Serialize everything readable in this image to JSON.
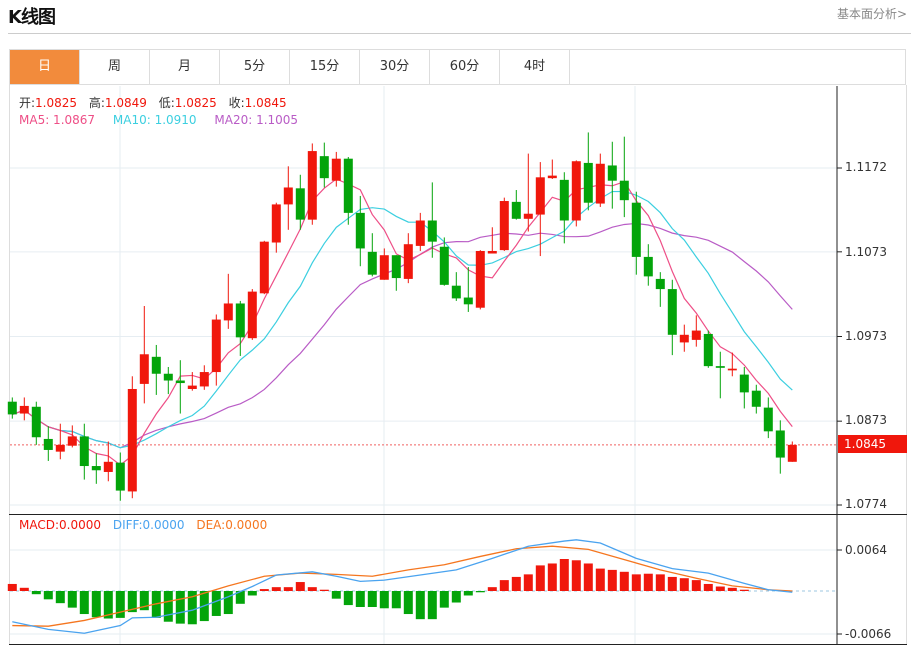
{
  "header": {
    "title": "K线图",
    "more_link": "基本面分析>"
  },
  "tabs": [
    {
      "label": "日",
      "active": true
    },
    {
      "label": "周"
    },
    {
      "label": "月"
    },
    {
      "label": "5分"
    },
    {
      "label": "15分"
    },
    {
      "label": "30分"
    },
    {
      "label": "60分"
    },
    {
      "label": "4时"
    }
  ],
  "ohlc_info": {
    "open_label": "开:",
    "open": "1.0825",
    "high_label": "高:",
    "high": "1.0849",
    "low_label": "低:",
    "low": "1.0825",
    "close_label": "收:",
    "close": "1.0845"
  },
  "ma_info": {
    "ma5": "MA5: 1.0867",
    "ma10": "MA10: 1.0910",
    "ma20": "MA20: 1.1005"
  },
  "macd_info": {
    "macd": "MACD:0.0000",
    "diff": "DIFF:0.0000",
    "dea": "DEA:0.0000"
  },
  "colors": {
    "up": "#f0170c",
    "down": "#03a40a",
    "ma5": "#ee4f87",
    "ma10": "#3ccfe0",
    "ma20": "#b95cc6",
    "diff": "#4aa3ef",
    "dea": "#f5761f",
    "accent": "#f28b3c"
  },
  "chart_data": {
    "type": "candlestick",
    "price_axis": {
      "ticks": [
        "1.1172",
        "1.1073",
        "1.0973",
        "1.0873",
        "1.0774"
      ],
      "range": [
        1.0774,
        1.1172
      ]
    },
    "current_price": "1.0845",
    "candles": [
      [
        1.0896,
        1.0901,
        1.0876,
        1.0881
      ],
      [
        1.0882,
        1.0901,
        1.0874,
        1.0891
      ],
      [
        1.089,
        1.0896,
        1.0845,
        1.0854
      ],
      [
        1.0852,
        1.0867,
        1.0826,
        1.0839
      ],
      [
        1.0837,
        1.087,
        1.0828,
        1.0845
      ],
      [
        1.0844,
        1.0868,
        1.0842,
        1.0855
      ],
      [
        1.0855,
        1.087,
        1.0804,
        1.082
      ],
      [
        1.082,
        1.0835,
        1.0799,
        1.0815
      ],
      [
        1.0813,
        1.0849,
        1.0802,
        1.0825
      ],
      [
        1.0824,
        1.0836,
        1.0779,
        1.0791
      ],
      [
        1.079,
        1.0926,
        1.0782,
        1.0911
      ],
      [
        1.0917,
        1.1009,
        1.0894,
        1.0952
      ],
      [
        1.0949,
        1.0963,
        1.0904,
        1.0929
      ],
      [
        1.0929,
        1.0937,
        1.0905,
        1.0921
      ],
      [
        1.0921,
        1.0945,
        1.0882,
        1.0918
      ],
      [
        1.0911,
        1.0931,
        1.0909,
        1.0915
      ],
      [
        1.0914,
        1.0939,
        1.091,
        1.0931
      ],
      [
        1.0931,
        1.0999,
        1.0915,
        1.0993
      ],
      [
        1.0992,
        1.1047,
        1.0982,
        1.1012
      ],
      [
        1.1012,
        1.1015,
        1.095,
        1.0972
      ],
      [
        1.0971,
        1.1029,
        1.0969,
        1.1026
      ],
      [
        1.1024,
        1.1086,
        1.1023,
        1.1085
      ],
      [
        1.1084,
        1.1131,
        1.1072,
        1.1129
      ],
      [
        1.1129,
        1.1174,
        1.1099,
        1.1149
      ],
      [
        1.1148,
        1.1164,
        1.1099,
        1.1111
      ],
      [
        1.1111,
        1.1201,
        1.1105,
        1.1192
      ],
      [
        1.1186,
        1.1202,
        1.1149,
        1.116
      ],
      [
        1.1157,
        1.1191,
        1.115,
        1.1183
      ],
      [
        1.1183,
        1.1185,
        1.1105,
        1.1119
      ],
      [
        1.1119,
        1.1139,
        1.1056,
        1.1077
      ],
      [
        1.1073,
        1.1095,
        1.1044,
        1.1046
      ],
      [
        1.104,
        1.1077,
        1.104,
        1.1069
      ],
      [
        1.1069,
        1.1069,
        1.1027,
        1.1042
      ],
      [
        1.1041,
        1.1095,
        1.1036,
        1.1082
      ],
      [
        1.108,
        1.1119,
        1.1074,
        1.111
      ],
      [
        1.111,
        1.1155,
        1.1066,
        1.1085
      ],
      [
        1.1079,
        1.109,
        1.1033,
        1.1034
      ],
      [
        1.1033,
        1.1049,
        1.1015,
        1.1018
      ],
      [
        1.1019,
        1.1055,
        1.1002,
        1.1011
      ],
      [
        1.1007,
        1.1075,
        1.1005,
        1.1074
      ],
      [
        1.1071,
        1.1102,
        1.1071,
        1.1074
      ],
      [
        1.1075,
        1.1137,
        1.1074,
        1.1133
      ],
      [
        1.1132,
        1.1146,
        1.1111,
        1.1112
      ],
      [
        1.1112,
        1.1189,
        1.1097,
        1.1118
      ],
      [
        1.1117,
        1.1179,
        1.1068,
        1.1161
      ],
      [
        1.116,
        1.1182,
        1.1159,
        1.1163
      ],
      [
        1.1158,
        1.1167,
        1.1083,
        1.111
      ],
      [
        1.111,
        1.1181,
        1.1103,
        1.118
      ],
      [
        1.1178,
        1.1214,
        1.1122,
        1.1131
      ],
      [
        1.113,
        1.1189,
        1.1126,
        1.1177
      ],
      [
        1.1175,
        1.1203,
        1.1124,
        1.1157
      ],
      [
        1.1157,
        1.1209,
        1.1114,
        1.1134
      ],
      [
        1.1131,
        1.1144,
        1.1046,
        1.1067
      ],
      [
        1.1067,
        1.1082,
        1.1033,
        1.1044
      ],
      [
        1.1041,
        1.1049,
        1.1008,
        1.1029
      ],
      [
        1.1029,
        1.104,
        1.0951,
        1.0975
      ],
      [
        1.0966,
        1.0987,
        1.0955,
        1.0975
      ],
      [
        1.0969,
        1.0998,
        1.0961,
        1.098
      ],
      [
        1.0976,
        1.098,
        1.0936,
        1.0938
      ],
      [
        1.0938,
        1.0955,
        1.09,
        1.0936
      ],
      [
        1.0933,
        1.0954,
        1.0926,
        1.0935
      ],
      [
        1.0928,
        1.0937,
        1.0888,
        1.0907
      ],
      [
        1.0909,
        1.0916,
        1.0882,
        1.089
      ],
      [
        1.0889,
        1.0901,
        1.0853,
        1.0861
      ],
      [
        1.0862,
        1.0874,
        1.0811,
        1.083
      ],
      [
        1.0825,
        1.0849,
        1.0825,
        1.0845
      ]
    ],
    "macd": {
      "axis_ticks": [
        "0.0064",
        "-0.0066"
      ],
      "histogram": [
        0.0011,
        0.0005,
        -0.0005,
        -0.0013,
        -0.0019,
        -0.0026,
        -0.0036,
        -0.0041,
        -0.0043,
        -0.0042,
        -0.0033,
        -0.003,
        -0.0042,
        -0.0048,
        -0.0051,
        -0.0052,
        -0.0047,
        -0.0039,
        -0.0036,
        -0.002,
        -0.0007,
        0.0003,
        0.0006,
        0.0006,
        0.0014,
        0.0006,
        0.0002,
        -0.0012,
        -0.0022,
        -0.0025,
        -0.0025,
        -0.0027,
        -0.0027,
        -0.0036,
        -0.0044,
        -0.0044,
        -0.0026,
        -0.0018,
        -0.0007,
        -0.0002,
        0.0006,
        0.0017,
        0.0022,
        0.0026,
        0.004,
        0.0043,
        0.005,
        0.0048,
        0.0043,
        0.0035,
        0.0033,
        0.003,
        0.0026,
        0.0027,
        0.0026,
        0.0022,
        0.002,
        0.0017,
        0.0011,
        0.0007,
        0.0005,
        0.0002,
        0,
        0,
        0,
        0
      ],
      "diff": [
        [
          0,
          -0.0048
        ],
        [
          3,
          -0.006
        ],
        [
          6,
          -0.0066
        ],
        [
          9,
          -0.0054
        ],
        [
          10,
          -0.0042
        ],
        [
          12,
          -0.0041
        ],
        [
          15,
          -0.003
        ],
        [
          18,
          -0.0009
        ],
        [
          20,
          0.0007
        ],
        [
          22,
          0.0025
        ],
        [
          25,
          0.003
        ],
        [
          27,
          0.0023
        ],
        [
          29,
          0.0015
        ],
        [
          31,
          0.0017
        ],
        [
          34,
          0.0025
        ],
        [
          37,
          0.0033
        ],
        [
          40,
          0.0051
        ],
        [
          43,
          0.007
        ],
        [
          46,
          0.0078
        ],
        [
          47,
          0.008
        ],
        [
          49,
          0.0075
        ],
        [
          52,
          0.0051
        ],
        [
          55,
          0.0035
        ],
        [
          58,
          0.0028
        ],
        [
          61,
          0.0012
        ],
        [
          63,
          0.0002
        ],
        [
          65,
          -0.0002
        ]
      ],
      "dea": [
        [
          0,
          -0.0054
        ],
        [
          3,
          -0.0055
        ],
        [
          6,
          -0.0046
        ],
        [
          9,
          -0.0033
        ],
        [
          12,
          -0.002
        ],
        [
          15,
          -0.0009
        ],
        [
          18,
          0.0008
        ],
        [
          21,
          0.0023
        ],
        [
          24,
          0.0028
        ],
        [
          27,
          0.0026
        ],
        [
          30,
          0.0023
        ],
        [
          33,
          0.0033
        ],
        [
          36,
          0.0041
        ],
        [
          39,
          0.0054
        ],
        [
          42,
          0.0066
        ],
        [
          45,
          0.007
        ],
        [
          48,
          0.0065
        ],
        [
          51,
          0.0049
        ],
        [
          54,
          0.0033
        ],
        [
          57,
          0.002
        ],
        [
          60,
          0.0008
        ],
        [
          63,
          0.0002
        ],
        [
          65,
          0
        ]
      ]
    }
  }
}
